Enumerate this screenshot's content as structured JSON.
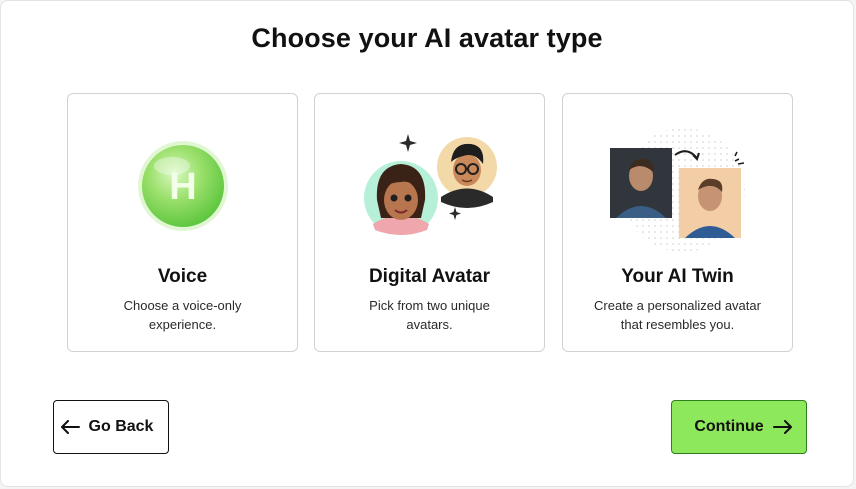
{
  "page": {
    "title": "Choose your AI avatar type"
  },
  "options": [
    {
      "title": "Voice",
      "description": "Choose a voice-only experience.",
      "badge_letter": "H"
    },
    {
      "title": "Digital Avatar",
      "description": "Pick from two unique avatars."
    },
    {
      "title": "Your AI Twin",
      "description": "Create a personalized avatar that resembles you."
    }
  ],
  "actions": {
    "back_label": "Go Back",
    "continue_label": "Continue"
  },
  "colors": {
    "accent": "#8ee85c",
    "voice_orb": "#9be06c",
    "card_border": "#d2d2d6"
  }
}
